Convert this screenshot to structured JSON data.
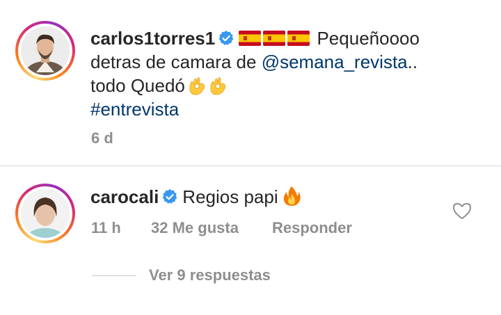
{
  "post": {
    "username": "carlos1torres1",
    "verified": true,
    "flags": [
      "spain-flag",
      "spain-flag",
      "spain-flag"
    ],
    "text_line1": "Pequeñoooo",
    "text_line2_prefix": "detras de camara de ",
    "mention": "@semana_revista",
    "text_line2_suffix": "..",
    "text_line3": "todo Quedó",
    "emojis_line3": [
      "ok-hand-emoji",
      "ok-hand-emoji"
    ],
    "hashtag": "#entrevista",
    "time": "6 d"
  },
  "comment": {
    "username": "carocali",
    "verified": true,
    "text": "Regios papi",
    "emoji": "fire-emoji",
    "time": "11 h",
    "likes": "32 Me gusta",
    "reply_label": "Responder",
    "like_icon": "heart-outline-icon",
    "view_replies": "Ver 9 respuestas"
  },
  "colors": {
    "text": "#262626",
    "secondary": "#8e8e8e",
    "link": "#00376b",
    "verified": "#3897f0",
    "divider": "#dbdbdb"
  }
}
